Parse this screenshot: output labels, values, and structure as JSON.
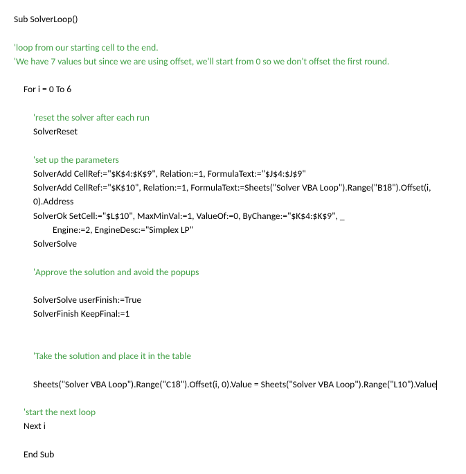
{
  "lines": [
    {
      "indent": 0,
      "cls": "",
      "text": "Sub SolverLoop()"
    },
    {
      "blank": true
    },
    {
      "indent": 0,
      "cls": "comment",
      "text": "'loop from our starting cell to the end."
    },
    {
      "indent": 0,
      "cls": "comment",
      "text": "'We have 7 values but since we are using offset, we'll start from 0 so we don't offset the first round."
    },
    {
      "blank": true
    },
    {
      "indent": 1,
      "cls": "",
      "text": "For i = 0 To 6"
    },
    {
      "blank": true
    },
    {
      "indent": 2,
      "cls": "comment",
      "text": "'reset the solver after each run"
    },
    {
      "indent": 2,
      "cls": "",
      "text": "SolverReset"
    },
    {
      "blank": true
    },
    {
      "indent": 2,
      "cls": "comment",
      "text": "'set up the parameters"
    },
    {
      "indent": 2,
      "cls": "",
      "text": "SolverAdd CellRef:=\"$K$4:$K$9\", Relation:=1, FormulaText:=\"$J$4:$J$9\""
    },
    {
      "indent": 2,
      "cls": "",
      "text": "SolverAdd CellRef:=\"$K$10\", Relation:=1, FormulaText:=Sheets(\"Solver VBA Loop\").Range(\"B18\").Offset(i, 0).Address"
    },
    {
      "indent": 2,
      "cls": "",
      "text": "SolverOk SetCell:=\"$L$10\", MaxMinVal:=1, ValueOf:=0, ByChange:=\"$K$4:$K$9\", _"
    },
    {
      "indent": 3,
      "cls": "",
      "text": "Engine:=2, EngineDesc:=\"Simplex LP\""
    },
    {
      "indent": 2,
      "cls": "",
      "text": "SolverSolve"
    },
    {
      "blank": true
    },
    {
      "indent": 2,
      "cls": "comment",
      "text": "'Approve the solution and avoid the popups"
    },
    {
      "blank": true
    },
    {
      "indent": 2,
      "cls": "",
      "text": "SolverSolve userFinish:=True"
    },
    {
      "indent": 2,
      "cls": "",
      "text": "SolverFinish KeepFinal:=1"
    },
    {
      "blank": true
    },
    {
      "blank": true
    },
    {
      "indent": 2,
      "cls": "comment",
      "text": "'Take the solution and place it in the table"
    },
    {
      "blank": true
    },
    {
      "indent": 2,
      "cls": "",
      "text": "Sheets(\"Solver VBA Loop\").Range(\"C18\").Offset(i, 0).Value = Sheets(\"Solver VBA Loop\").Range(\"L10\").Value",
      "cursor": true
    },
    {
      "blank": true
    },
    {
      "indent": 1,
      "cls": "comment",
      "text": "'start the next loop"
    },
    {
      "indent": 1,
      "cls": "",
      "text": "Next i"
    },
    {
      "blank": true
    },
    {
      "indent": 1,
      "cls": "",
      "text": "End Sub"
    }
  ]
}
